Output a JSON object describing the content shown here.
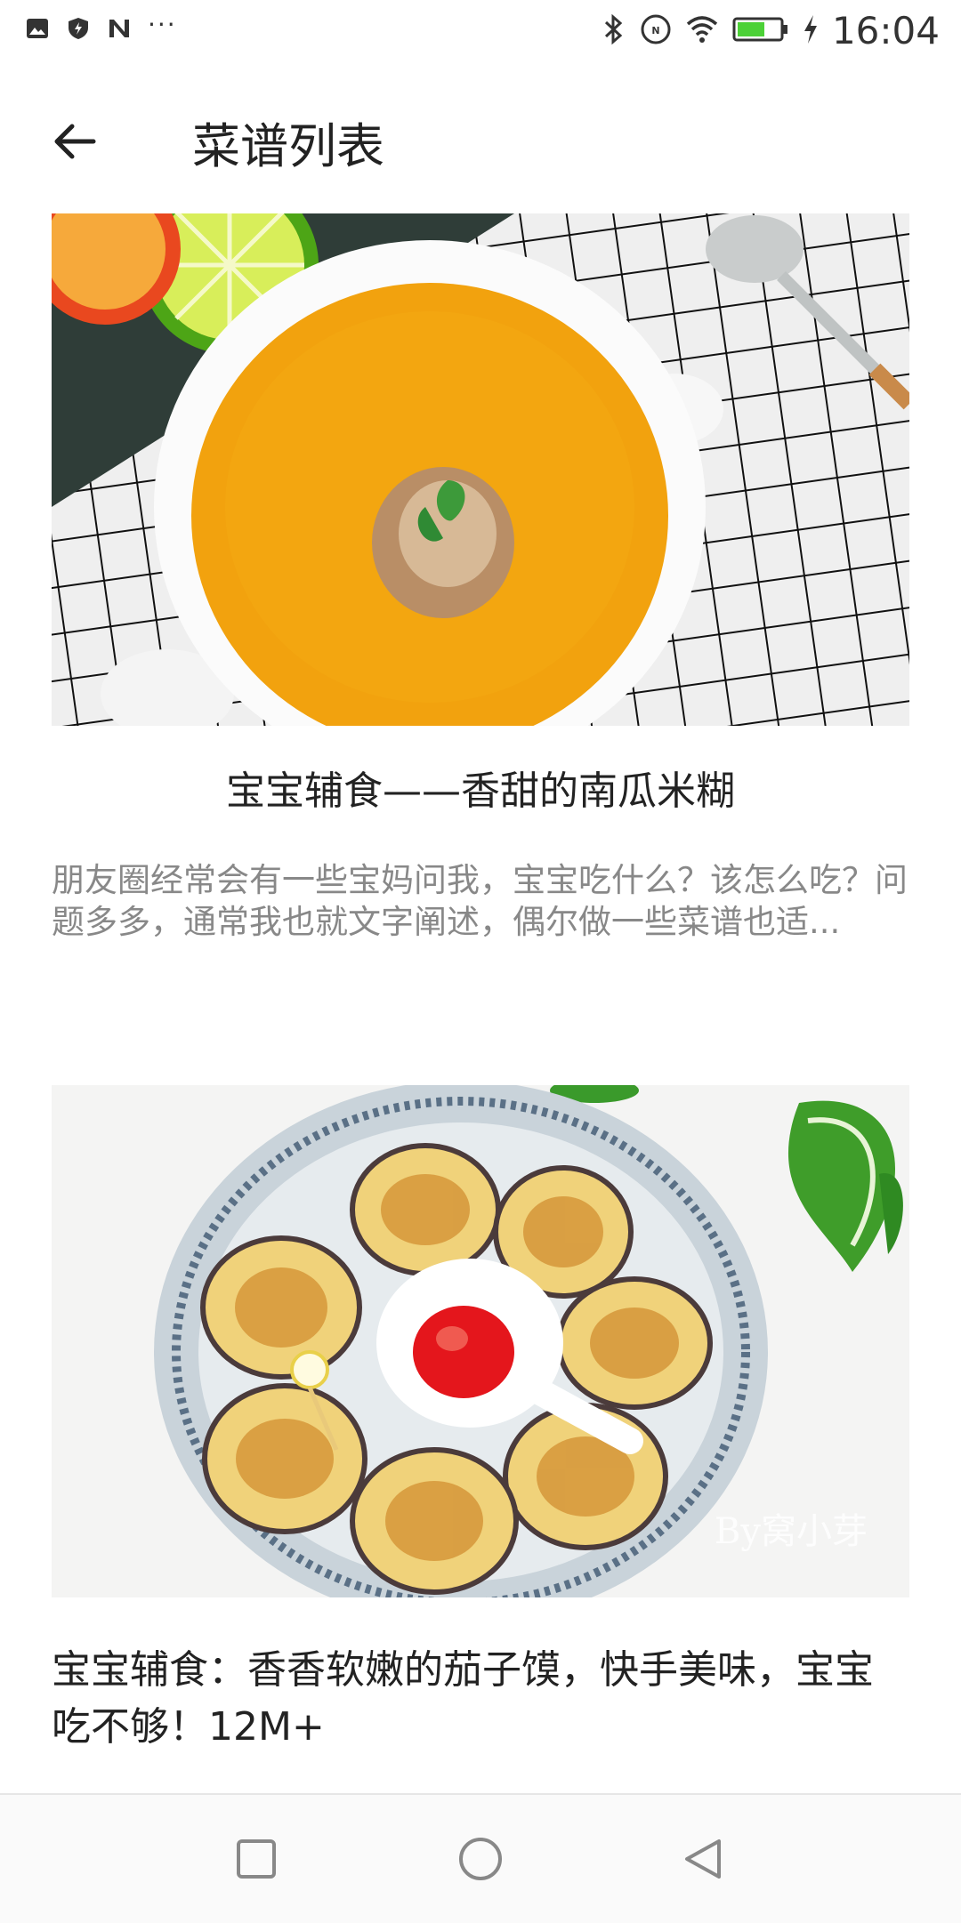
{
  "status_bar": {
    "time": "16:04",
    "left_icons": [
      "image-icon",
      "shield-icon",
      "n-app-icon"
    ],
    "dots": "···",
    "right_icons": [
      "bluetooth-icon",
      "nfc-icon",
      "wifi-icon",
      "battery-icon",
      "charging-icon"
    ]
  },
  "app_bar": {
    "title": "菜谱列表"
  },
  "recipes": [
    {
      "title": "宝宝辅食——香甜的南瓜米糊",
      "description": "朋友圈经常会有一些宝妈问我，宝宝吃什么？该怎么吃？问题多多，通常我也就文字阐述，偶尔做一些菜谱也适...",
      "image": "pumpkin-soup-photo"
    },
    {
      "title": "宝宝辅食：香香软嫩的茄子馍，快手美味，宝宝吃不够！12M+",
      "image": "eggplant-pancake-photo",
      "watermark": "By窝小芽"
    }
  ],
  "colors": {
    "text": "#222222",
    "secondary_text": "#888888",
    "soup": "#f2a20e"
  }
}
